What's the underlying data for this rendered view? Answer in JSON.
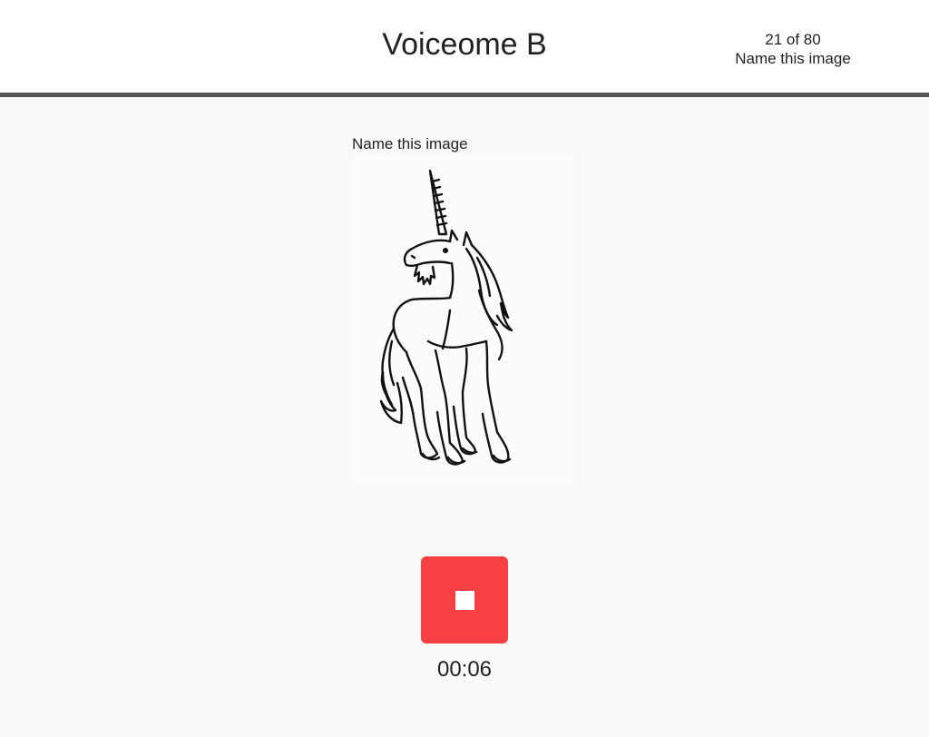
{
  "header": {
    "title": "Voiceome B",
    "progress_count": "21 of 80",
    "progress_task": "Name this image"
  },
  "task": {
    "prompt": "Name this image",
    "image_subject": "unicorn line drawing"
  },
  "recorder": {
    "state": "recording",
    "button_icon": "stop-icon",
    "elapsed": "00:06",
    "button_color": "#f94144"
  },
  "colors": {
    "header_border": "#555555",
    "background": "#f9f9f9"
  }
}
